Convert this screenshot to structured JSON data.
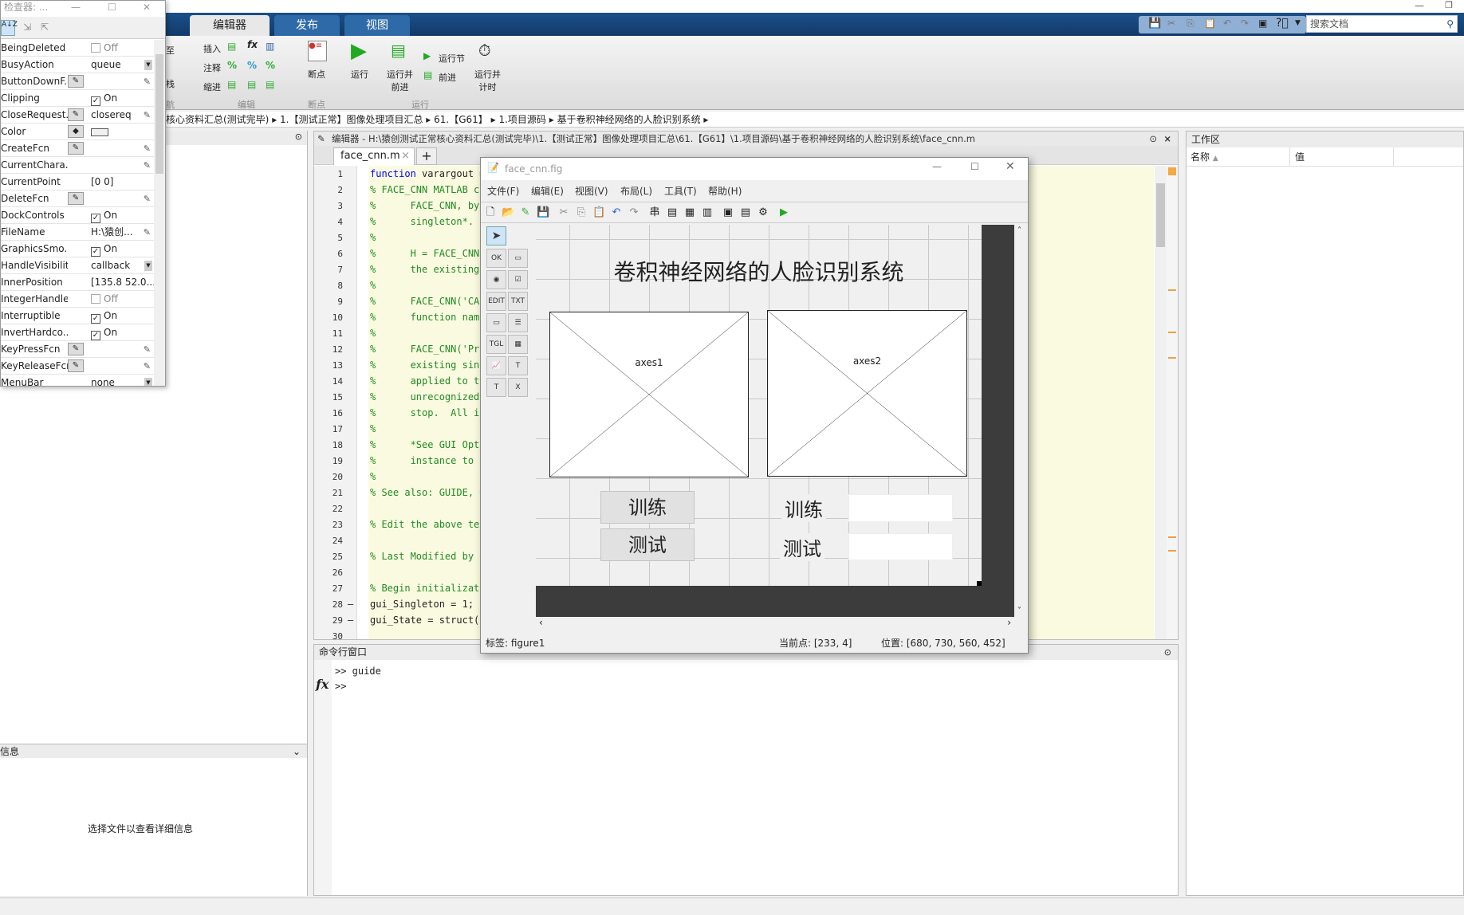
{
  "ribbon": {
    "tabs": [
      "编辑器",
      "发布",
      "视图"
    ],
    "hidden_items": [
      "至",
      "栈",
      "航"
    ],
    "edit_group": {
      "insert": "插入",
      "comment": "注释",
      "indent": "缩进",
      "label": "编辑"
    },
    "breakpoint_group": {
      "button": "断点",
      "label": "断点"
    },
    "run_group": {
      "run": "运行",
      "run_advance": "运行并\n前进",
      "run_section": "运行节",
      "advance": "前进",
      "run_time": "运行并\n计时",
      "label": "运行"
    },
    "search_placeholder": "搜索文档"
  },
  "breadcrumb": [
    "核心资料汇总(测试完毕)",
    "1.【测试正常】图像处理项目汇总",
    "61.【G61】",
    "1.项目源码",
    "基于卷积神经网络的人脸识别系统"
  ],
  "inspector": {
    "title": "检查器: ...",
    "rows": [
      {
        "name": "BeingDeleted",
        "value": "Off",
        "kind": "check",
        "checked": false
      },
      {
        "name": "BusyAction",
        "value": "queue",
        "kind": "dropdown"
      },
      {
        "name": "ButtonDownF...",
        "value": "",
        "kind": "callback"
      },
      {
        "name": "Clipping",
        "value": "On",
        "kind": "check",
        "checked": true
      },
      {
        "name": "CloseRequest...",
        "value": "closereq",
        "kind": "callback"
      },
      {
        "name": "Color",
        "value": "",
        "kind": "color"
      },
      {
        "name": "CreateFcn",
        "value": "",
        "kind": "callback"
      },
      {
        "name": "CurrentChara...",
        "value": "",
        "kind": "edit"
      },
      {
        "name": "CurrentPoint",
        "value": "[0 0]",
        "kind": "text"
      },
      {
        "name": "DeleteFcn",
        "value": "",
        "kind": "callback"
      },
      {
        "name": "DockControls",
        "value": "On",
        "kind": "check",
        "checked": true
      },
      {
        "name": "FileName",
        "value": "H:\\猿创...",
        "kind": "edit"
      },
      {
        "name": "GraphicsSmo...",
        "value": "On",
        "kind": "check",
        "checked": true
      },
      {
        "name": "HandleVisibility",
        "value": "callback",
        "kind": "dropdown"
      },
      {
        "name": "InnerPosition",
        "value": "[135.8 52.0...",
        "kind": "text"
      },
      {
        "name": "IntegerHandle",
        "value": "Off",
        "kind": "check",
        "checked": false
      },
      {
        "name": "Interruptible",
        "value": "On",
        "kind": "check",
        "checked": true
      },
      {
        "name": "InvertHardco...",
        "value": "On",
        "kind": "check",
        "checked": true
      },
      {
        "name": "KeyPressFcn",
        "value": "",
        "kind": "callback"
      },
      {
        "name": "KeyReleaseFcn",
        "value": "",
        "kind": "callback"
      },
      {
        "name": "MenuBar",
        "value": "none",
        "kind": "dropdown"
      }
    ]
  },
  "left_panel": {
    "details_header": "信息",
    "details_text": "选择文件以查看详细信息"
  },
  "editor": {
    "title": "编辑器 - H:\\猿创测试正常核心资料汇总(测试完毕)\\1.【测试正常】图像处理项目汇总\\61.【G61】\\1.项目源码\\基于卷积神经网络的人脸识别系统\\face_cnn.m",
    "tab": "face_cnn.m",
    "lines": [
      "function varargout =",
      "% FACE_CNN MATLAB co",
      "%      FACE_CNN, by",
      "%      singleton*.",
      "%",
      "%      H = FACE_CNN",
      "%      the existing",
      "%",
      "%      FACE_CNN('CAL",
      "%      function name",
      "%",
      "%      FACE_CNN('Pro",
      "%      existing sing",
      "%      applied to th",
      "%      unrecognized",
      "%      stop.  All in",
      "%",
      "%      *See GUI Opti",
      "%      instance to r",
      "%",
      "% See also: GUIDE, G",
      "",
      "% Edit the above tex",
      "",
      "% Last Modified by G",
      "",
      "% Begin initializati",
      "gui_Singleton = 1;",
      "gui_State = struct('",
      "                   '"
    ]
  },
  "command_window": {
    "title": "命令行窗口",
    "history": ">> guide",
    "prompt": ">>"
  },
  "workspace": {
    "title": "工作区",
    "col_name": "名称",
    "col_value": "值"
  },
  "guide": {
    "title": "face_cnn.fig",
    "menus": [
      "文件(F)",
      "编辑(E)",
      "视图(V)",
      "布局(L)",
      "工具(T)",
      "帮助(H)"
    ],
    "figure_title": "卷积神经网络的人脸识别系统",
    "axes": [
      "axes1",
      "axes2"
    ],
    "buttons": [
      "训练",
      "测试"
    ],
    "labels": [
      "训练",
      "测试"
    ],
    "edits": [
      "",
      ""
    ],
    "palette": [
      "OK",
      "▭",
      "◉",
      "☑",
      "EDIT",
      "TXT",
      "▭",
      "☰",
      "TGL",
      "▦",
      "📈",
      "T",
      "T",
      "X"
    ],
    "status": {
      "tag": "标签: figure1",
      "current_point": "当前点:  [233, 4]",
      "position": "位置: [680, 730, 560, 452]"
    }
  },
  "colors": {
    "ribbon_blue": "#1b4f8a",
    "code_bg": "#fafae0",
    "comment": "#228b22",
    "keyword": "#0000ff"
  }
}
